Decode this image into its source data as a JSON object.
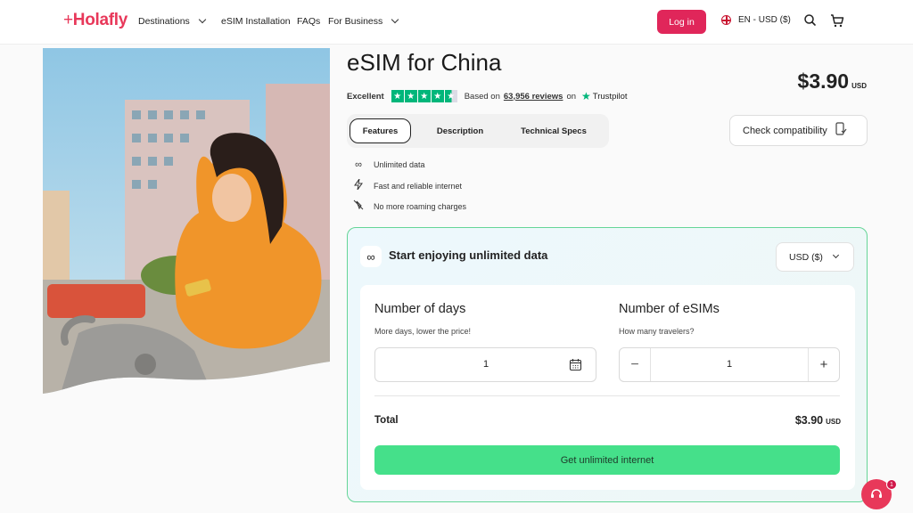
{
  "header": {
    "logo": "Holafly",
    "nav": [
      "Destinations",
      "eSIM Installation",
      "FAQs",
      "For Business"
    ],
    "login": "Log in",
    "language": "EN - USD ($)"
  },
  "product": {
    "title": "eSIM for China",
    "rating_label": "Excellent",
    "reviews_prefix": "Based on",
    "reviews_count": "63,956 reviews",
    "reviews_suffix": "on",
    "trustpilot": "Trustpilot",
    "price": "$3.90",
    "price_currency": "USD"
  },
  "tabs": [
    "Features",
    "Description",
    "Technical Specs"
  ],
  "check_compatibility": "Check compatibility",
  "features": [
    {
      "icon": "infinity-icon",
      "text": "Unlimited data"
    },
    {
      "icon": "lightning-icon",
      "text": "Fast and reliable internet"
    },
    {
      "icon": "no-roaming-icon",
      "text": "No more roaming charges"
    }
  ],
  "card": {
    "title": "Start enjoying unlimited data",
    "currency_select": "USD ($)",
    "days_heading": "Number of days",
    "days_sub": "More days, lower the price!",
    "days_value": "1",
    "esims_heading": "Number of eSIMs",
    "esims_sub": "How many travelers?",
    "esims_value": "1",
    "total_label": "Total",
    "total_value": "$3.90",
    "total_currency": "USD",
    "cta": "Get unlimited internet"
  },
  "chat_badge": "1",
  "colors": {
    "brand": "#e8385a",
    "accent_green": "#45e08a",
    "trustpilot": "#00b67a"
  }
}
